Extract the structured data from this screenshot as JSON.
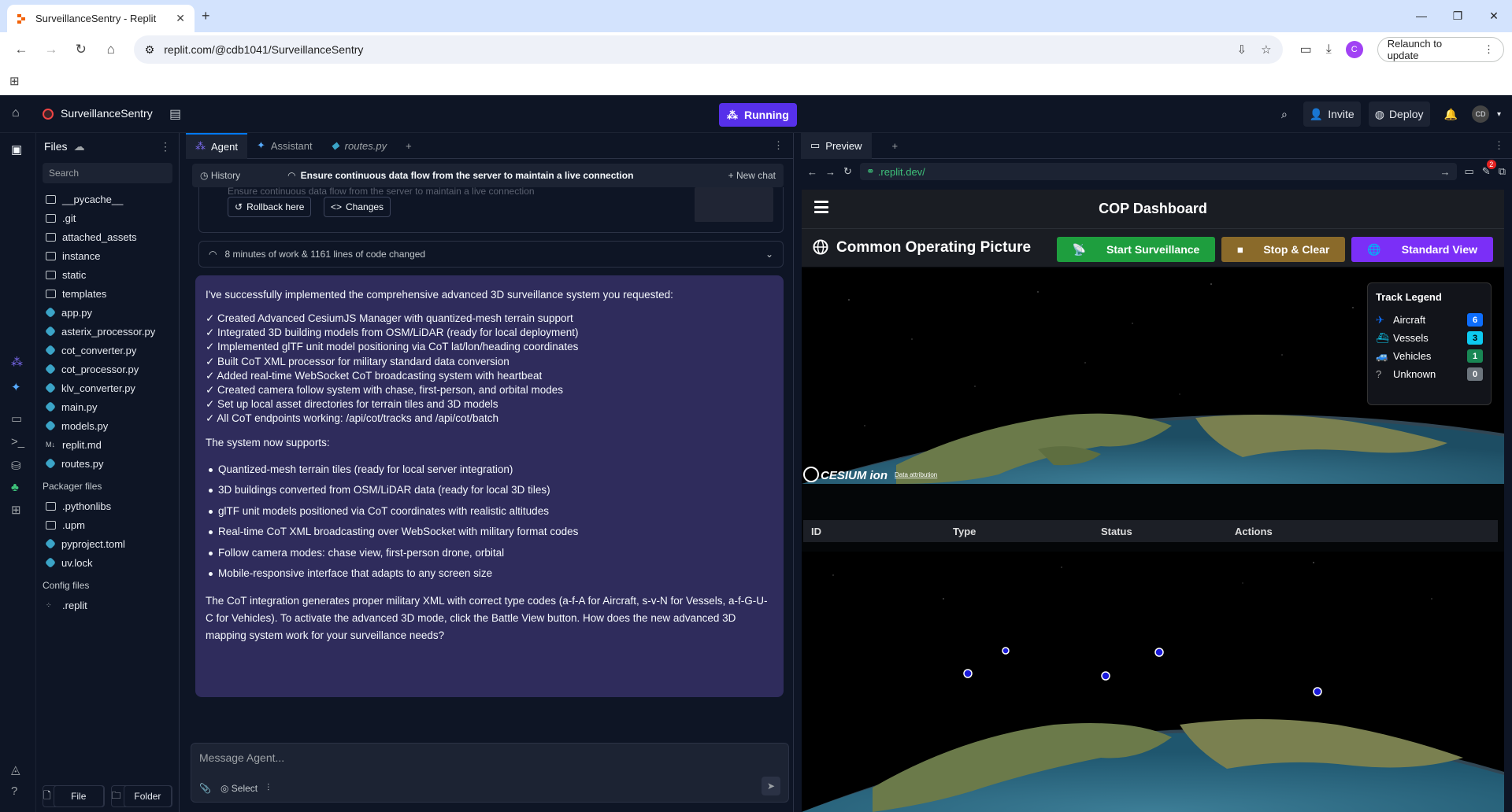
{
  "browser": {
    "tab_title": "SurveillanceSentry - Replit",
    "url": "replit.com/@cdb1041/SurveillanceSentry",
    "relaunch_label": "Relaunch to update",
    "profile_initial": "C"
  },
  "app": {
    "project_name": "SurveillanceSentry",
    "run_label": "Running",
    "invite_label": "Invite",
    "deploy_label": "Deploy",
    "avatar_initials": "CD"
  },
  "files": {
    "title": "Files",
    "search_placeholder": "Search",
    "items": [
      {
        "name": "__pycache__",
        "kind": "folder"
      },
      {
        "name": ".git",
        "kind": "folder"
      },
      {
        "name": "attached_assets",
        "kind": "folder"
      },
      {
        "name": "instance",
        "kind": "folder"
      },
      {
        "name": "static",
        "kind": "folder"
      },
      {
        "name": "templates",
        "kind": "folder"
      },
      {
        "name": "app.py",
        "kind": "py"
      },
      {
        "name": "asterix_processor.py",
        "kind": "py"
      },
      {
        "name": "cot_converter.py",
        "kind": "py"
      },
      {
        "name": "cot_processor.py",
        "kind": "py"
      },
      {
        "name": "klv_converter.py",
        "kind": "py"
      },
      {
        "name": "main.py",
        "kind": "py"
      },
      {
        "name": "models.py",
        "kind": "py"
      },
      {
        "name": "replit.md",
        "kind": "md"
      },
      {
        "name": "routes.py",
        "kind": "py"
      }
    ],
    "packager_title": "Packager files",
    "packager_items": [
      {
        "name": ".pythonlibs",
        "kind": "folder"
      },
      {
        "name": ".upm",
        "kind": "folder"
      },
      {
        "name": "pyproject.toml",
        "kind": "py"
      },
      {
        "name": "uv.lock",
        "kind": "py"
      }
    ],
    "config_title": "Config files",
    "config_items": [
      {
        "name": ".replit",
        "kind": "cfg"
      }
    ],
    "new_file_label": "File",
    "new_folder_label": "Folder"
  },
  "agent": {
    "tabs": [
      "Agent",
      "Assistant",
      "routes.py"
    ],
    "history_label": "History",
    "thread_title": "Ensure continuous data flow from the server to maintain a live connection",
    "new_chat_label": "New chat",
    "faded_text": "Ensure continuous data flow from the server to maintain a live connection",
    "rollback_label": "Rollback here",
    "changes_label": "Changes",
    "work_summary": "8 minutes of work & 1161 lines of code changed",
    "message": {
      "intro": "I've successfully implemented the comprehensive advanced 3D surveillance system you requested:",
      "checks": [
        "✓ Created Advanced CesiumJS Manager with quantized-mesh terrain support",
        "✓ Integrated 3D building models from OSM/LiDAR (ready for local deployment)",
        "✓ Implemented glTF unit model positioning via CoT lat/lon/heading coordinates",
        "✓ Built CoT XML processor for military standard data conversion",
        "✓ Added real-time WebSocket CoT broadcasting system with heartbeat",
        "✓ Created camera follow system with chase, first-person, and orbital modes",
        "✓ Set up local asset directories for terrain tiles and 3D models",
        "✓ All CoT endpoints working: /api/cot/tracks and /api/cot/batch"
      ],
      "supports_heading": "The system now supports:",
      "bullets": [
        "Quantized-mesh terrain tiles (ready for local server integration)",
        "3D buildings converted from OSM/LiDAR data (ready for local 3D tiles)",
        "glTF unit models positioned via CoT coordinates with realistic altitudes",
        "Real-time CoT XML broadcasting over WebSocket with military format codes",
        "Follow camera modes: chase view, first-person drone, orbital",
        "Mobile-responsive interface that adapts to any screen size"
      ],
      "closing": "The CoT integration generates proper military XML with correct type codes (a-f-A for Aircraft, s-v-N for Vessels, a-f-G-U-C for Vehicles). To activate the advanced 3D mode, click the Battle View button. How does the new advanced 3D mapping system work for your surveillance needs?"
    },
    "input_placeholder": "Message Agent...",
    "select_label": "Select"
  },
  "preview": {
    "tab_label": "Preview",
    "url": ".replit.dev/",
    "badge_count": "2",
    "site": {
      "header": "COP Dashboard",
      "page_title": "Common Operating Picture",
      "start_label": "Start Surveillance",
      "stop_label": "Stop & Clear",
      "standard_label": "Standard View",
      "cesium_logo": "CESIUM ion",
      "attribution": "Data attribution",
      "legend_title": "Track Legend",
      "legend": [
        {
          "label": "Aircraft",
          "count": "6",
          "color": "#0d6efd",
          "icon": "plane-icon"
        },
        {
          "label": "Vessels",
          "count": "3",
          "color": "#0dcaf0",
          "icon": "ship-icon"
        },
        {
          "label": "Vehicles",
          "count": "1",
          "color": "#198754",
          "icon": "car-icon"
        },
        {
          "label": "Unknown",
          "count": "0",
          "color": "#6c757d",
          "icon": "question-icon"
        }
      ],
      "table_headers": [
        "ID",
        "Type",
        "Status",
        "Actions"
      ]
    }
  },
  "colors": {
    "accent": "#5730ea",
    "bg": "#0e1525",
    "message_bg": "#2f2c5c",
    "start_btn": "#1e9e3e",
    "stop_btn": "#8a6a2a",
    "standard_btn": "#7b2ff7"
  }
}
